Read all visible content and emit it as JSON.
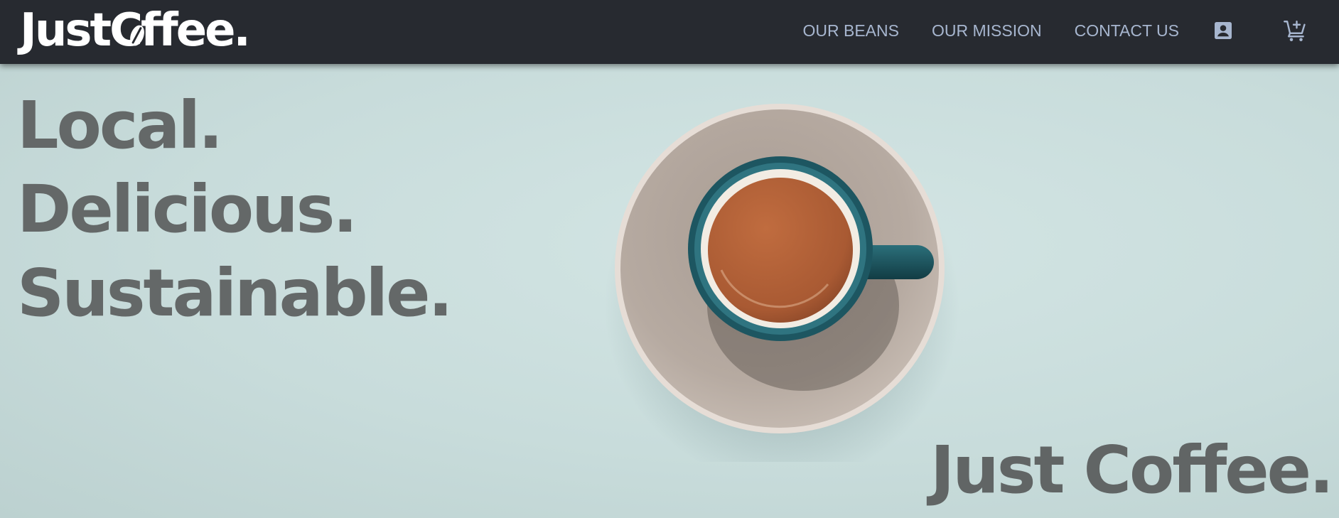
{
  "brand": {
    "logo_text_left": "Just",
    "logo_text_c": "C",
    "logo_text_right": "ffee."
  },
  "nav": {
    "links": [
      {
        "label": "OUR BEANS"
      },
      {
        "label": "OUR MISSION"
      },
      {
        "label": "CONTACT US"
      }
    ],
    "icons": [
      "account-box-icon",
      "add-shopping-cart-icon"
    ]
  },
  "hero": {
    "tagline": [
      "Local.",
      "Delicious.",
      "Sustainable."
    ],
    "brand_line": "Just Coffee."
  },
  "colors": {
    "navbar": "#272a30",
    "nav_link": "#a7b6cf",
    "hero_background": "#c9dedd",
    "heading_text": "#646868",
    "saucer": "#b3a79e",
    "cup": "#1f5a64",
    "coffee": "#b9643a"
  }
}
